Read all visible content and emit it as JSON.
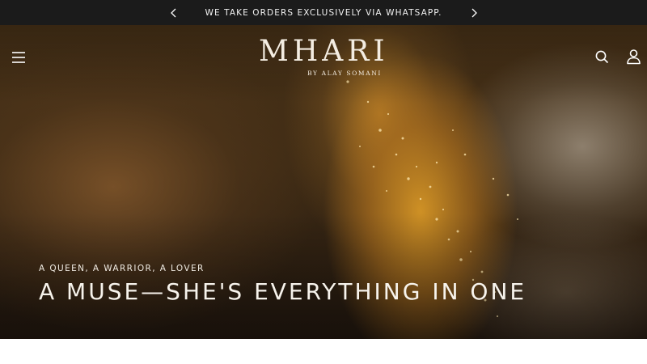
{
  "announcement": {
    "text": "WE TAKE ORDERS EXCLUSIVELY VIA WHATSAPP.",
    "prev_icon": "chevron-left-icon",
    "next_icon": "chevron-right-icon"
  },
  "header": {
    "menu_icon": "hamburger-menu-icon",
    "logo": {
      "wordmark": "MHARI",
      "tagline": "BY ALAY SOMANI"
    },
    "search_icon": "search-icon",
    "account_icon": "user-account-icon"
  },
  "hero": {
    "kicker": "A QUEEN, A WARRIOR, A LOVER",
    "title": "A MUSE—SHE'S EVERYTHING IN ONE"
  },
  "colors": {
    "announcement_bg": "#1b1b1b",
    "text_light": "#f4ede2",
    "page_bg": "#ffffff"
  }
}
